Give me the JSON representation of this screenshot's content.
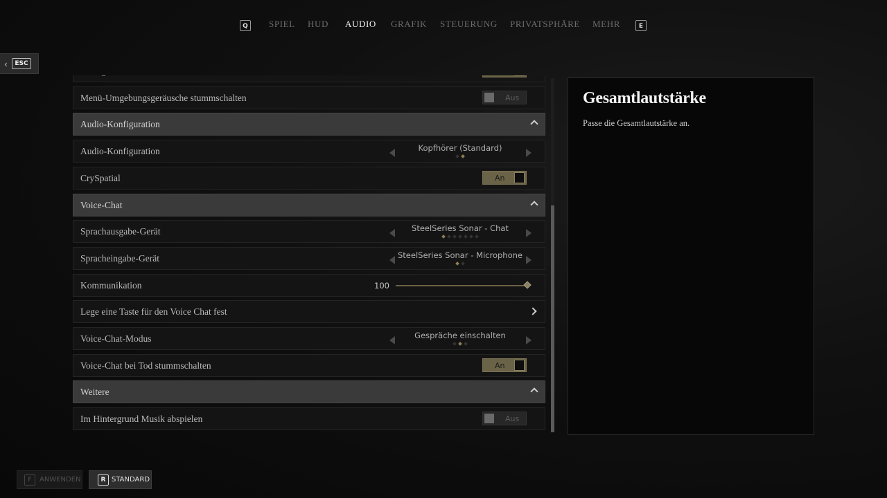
{
  "nav": {
    "left_key": "Q",
    "right_key": "E",
    "tabs": [
      {
        "label": "SPIEL",
        "active": false
      },
      {
        "label": "HUD",
        "active": false
      },
      {
        "label": "AUDIO",
        "active": true
      },
      {
        "label": "GRAFIK",
        "active": false
      },
      {
        "label": "STEUERUNG",
        "active": false
      },
      {
        "label": "PRIVATSPHÄRE",
        "active": false
      },
      {
        "label": "MEHR",
        "active": false
      }
    ]
  },
  "esc": {
    "key": "ESC"
  },
  "rows": [
    {
      "type": "toggle",
      "label": "Dialog-Untertitel",
      "state": "on",
      "value": "An"
    },
    {
      "type": "toggle",
      "label": "Menü-Umgebungsgeräusche stummschalten",
      "state": "off",
      "value": "Aus"
    },
    {
      "type": "header",
      "label": "Audio-Konfiguration"
    },
    {
      "type": "selector",
      "label": "Audio-Konfiguration",
      "value": "Kopfhörer (Standard)",
      "option_count": 2,
      "selected_index": 1
    },
    {
      "type": "toggle",
      "label": "CrySpatial",
      "state": "on",
      "value": "An"
    },
    {
      "type": "header",
      "label": "Voice-Chat"
    },
    {
      "type": "selector",
      "label": "Sprachausgabe-Gerät",
      "value": "SteelSeries Sonar - Chat",
      "option_count": 7,
      "selected_index": 0
    },
    {
      "type": "selector",
      "label": "Spracheingabe-Gerät",
      "value": "SteelSeries Sonar - Microphone",
      "option_count": 2,
      "selected_index": 0
    },
    {
      "type": "slider",
      "label": "Kommunikation",
      "value": "100",
      "fraction": 1.0
    },
    {
      "type": "link",
      "label": "Lege eine Taste für den Voice Chat fest"
    },
    {
      "type": "selector",
      "label": "Voice-Chat-Modus",
      "value": "Gespräche einschalten",
      "option_count": 3,
      "selected_index": 1
    },
    {
      "type": "toggle",
      "label": "Voice-Chat bei Tod stummschalten",
      "state": "on",
      "value": "An"
    },
    {
      "type": "header",
      "label": "Weitere"
    },
    {
      "type": "toggle",
      "label": "Im Hintergrund Musik abspielen",
      "state": "off",
      "value": "Aus"
    }
  ],
  "scrollbar": {
    "thumb_start": 0.36,
    "thumb_end": 1.0
  },
  "info": {
    "title": "Gesamtlautstärke",
    "description": "Passe die Gesamtlautstärke an."
  },
  "footer": {
    "apply": {
      "key": "F",
      "label": "ANWENDEN",
      "enabled": false
    },
    "standard": {
      "key": "R",
      "label": "STANDARD",
      "enabled": true
    }
  }
}
